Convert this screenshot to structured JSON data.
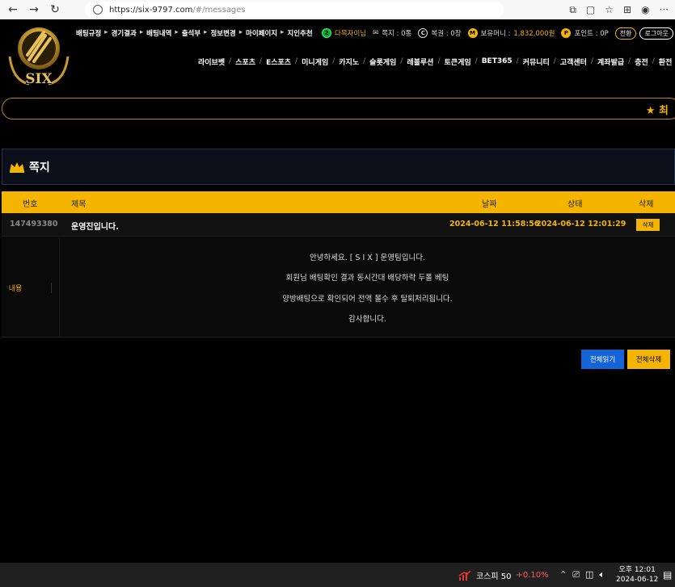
{
  "browser": {
    "url_host": "https://six-9797.com",
    "url_path": "/#/messages"
  },
  "header": {
    "logo_text": "SIX",
    "top_links": [
      "배팅규정",
      "경기결과",
      "배팅내역",
      "출석부",
      "정보변경",
      "마이페이지",
      "지인추천"
    ],
    "user": {
      "name": "다목자이님",
      "notes_label": "쪽지 : 0통",
      "coupons_label": "복권 : 0장",
      "balance_label": "보유머니 :",
      "balance_value": "1,832,000원",
      "points_label": "포인트 : 0P",
      "convert_btn": "전환",
      "logout_btn": "로그아웃"
    },
    "main_nav": [
      "라이브벳",
      "스포츠",
      "E스포츠",
      "미니게임",
      "카지노",
      "슬롯게임",
      "레볼루션",
      "토큰게임",
      "BET365",
      "커뮤니티",
      "고객센터",
      "계좌발급",
      "충전",
      "환전"
    ]
  },
  "marquee": {
    "text": "★ 최"
  },
  "section": {
    "title": "쪽지"
  },
  "table": {
    "headers": {
      "no": "번호",
      "subject": "제목",
      "date": "날짜",
      "status": "상태",
      "delete": "삭제"
    },
    "row": {
      "no": "147493380",
      "subject": "운영진입니다.",
      "date": "2024-06-12 11:58:56",
      "status": "2024-06-12 12:01:29",
      "delete_btn": "삭제"
    }
  },
  "content": {
    "label": "내용",
    "lines": [
      "안녕하세요. [ S I X ] 운영팀입니다.",
      "회원님 배팅확인 결과 동시간대 배당하락 두폴 베팅",
      "양방배팅으로 확인되어 전액 몰수 후 탈퇴처리됩니다.",
      "감사합니다."
    ]
  },
  "actions": {
    "read_all": "전체읽기",
    "delete_all": "전체삭제"
  },
  "taskbar": {
    "stock_name": "코스피 50",
    "stock_change": "+0.10%",
    "time": "오후 12:01",
    "date": "2024-06-12"
  },
  "colors": {
    "accent": "#f5b400",
    "blue": "#1464d8"
  }
}
